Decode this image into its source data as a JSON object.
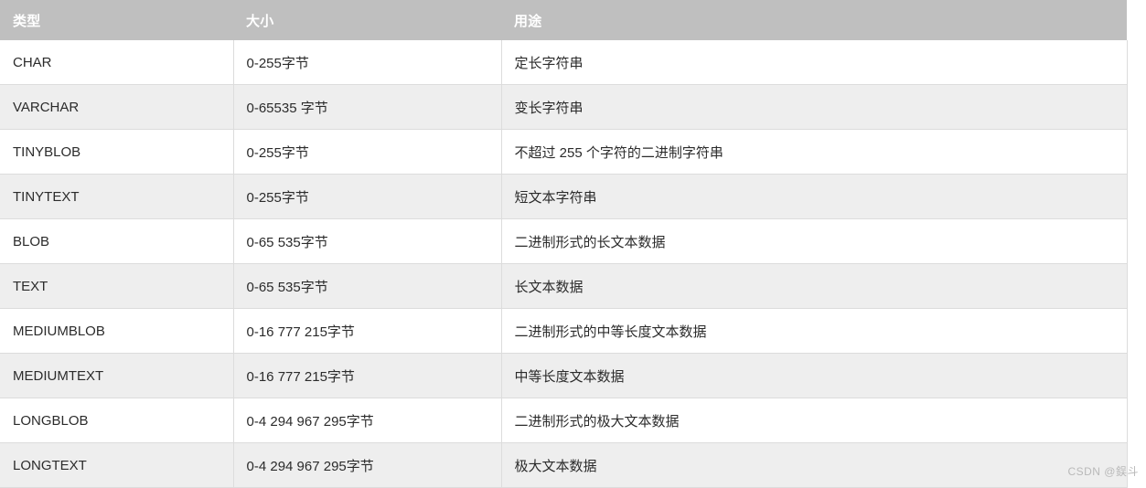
{
  "table": {
    "columns": [
      "类型",
      "大小",
      "用途"
    ],
    "rows": [
      {
        "type": "CHAR",
        "size": "0-255字节",
        "usage": "定长字符串"
      },
      {
        "type": "VARCHAR",
        "size": "0-65535 字节",
        "usage": "变长字符串"
      },
      {
        "type": "TINYBLOB",
        "size": "0-255字节",
        "usage": "不超过 255 个字符的二进制字符串"
      },
      {
        "type": "TINYTEXT",
        "size": "0-255字节",
        "usage": "短文本字符串"
      },
      {
        "type": "BLOB",
        "size": "0-65 535字节",
        "usage": "二进制形式的长文本数据"
      },
      {
        "type": "TEXT",
        "size": "0-65 535字节",
        "usage": "长文本数据"
      },
      {
        "type": "MEDIUMBLOB",
        "size": "0-16 777 215字节",
        "usage": "二进制形式的中等长度文本数据"
      },
      {
        "type": "MEDIUMTEXT",
        "size": "0-16 777 215字节",
        "usage": "中等长度文本数据"
      },
      {
        "type": "LONGBLOB",
        "size": "0-4 294 967 295字节",
        "usage": "二进制形式的极大文本数据"
      },
      {
        "type": "LONGTEXT",
        "size": "0-4 294 967 295字节",
        "usage": "极大文本数据"
      }
    ]
  },
  "watermark": {
    "text": "CSDN @鋘斗"
  },
  "colors": {
    "header_bg": "#bfbfbf",
    "header_text": "#ffffff",
    "row_odd_bg": "#ffffff",
    "row_even_bg": "#eeeeee",
    "border": "#dcdcdc",
    "body_text": "#2b2b2b",
    "watermark_text": "#b9b9b9"
  }
}
